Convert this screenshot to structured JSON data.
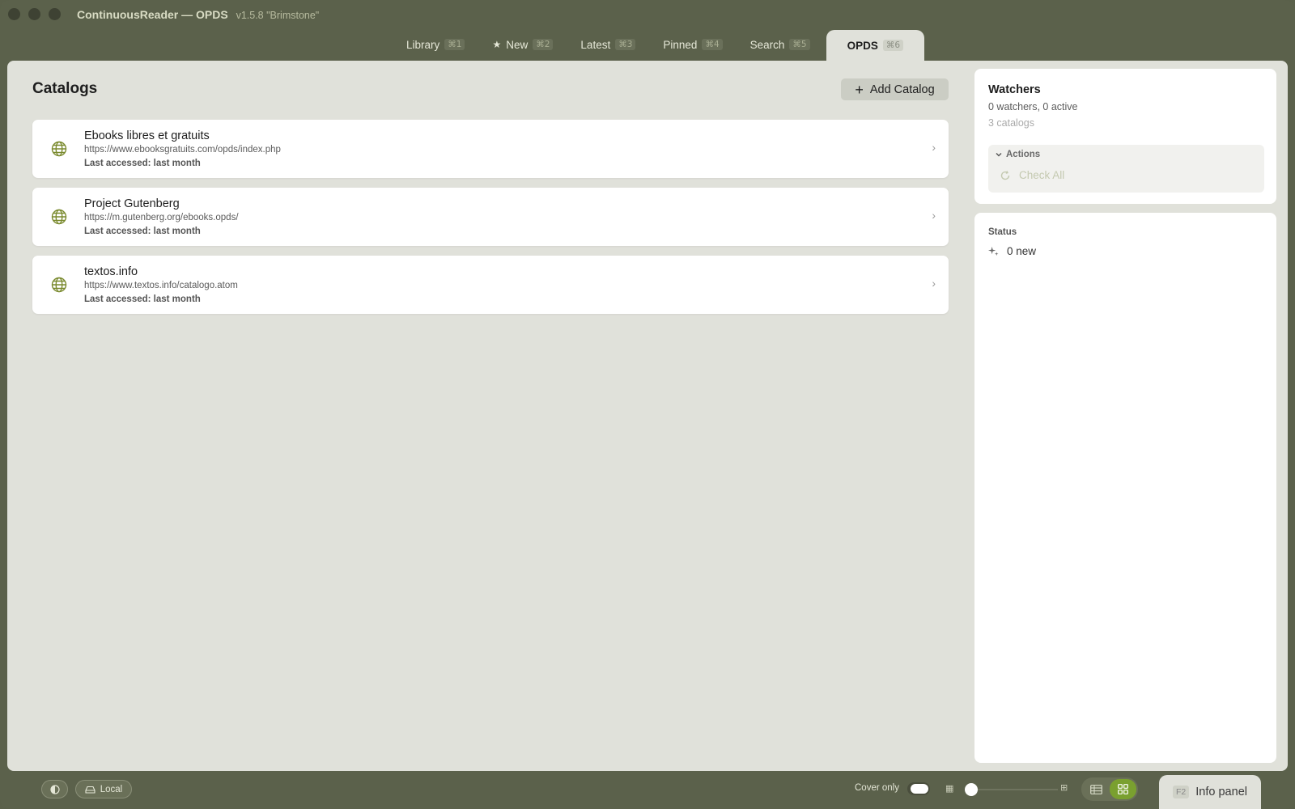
{
  "window": {
    "app_title": "ContinuousReader — OPDS",
    "version": "v1.5.8 \"Brimstone\""
  },
  "tabs": [
    {
      "label": "Library",
      "shortcut": "⌘1",
      "active": false
    },
    {
      "label": "New",
      "shortcut": "⌘2",
      "active": false,
      "icon": "star-icon"
    },
    {
      "label": "Latest",
      "shortcut": "⌘3",
      "active": false
    },
    {
      "label": "Pinned",
      "shortcut": "⌘4",
      "active": false
    },
    {
      "label": "Search",
      "shortcut": "⌘5",
      "active": false
    },
    {
      "label": "OPDS",
      "shortcut": "⌘6",
      "active": true
    }
  ],
  "catalogs_panel": {
    "title": "Catalogs",
    "add_button": "Add Catalog",
    "items": [
      {
        "name": "Ebooks libres et gratuits",
        "url": "https://www.ebooksgratuits.com/opds/index.php",
        "accessed": "Last accessed: last month",
        "icon": "globe-icon"
      },
      {
        "name": "Project Gutenberg",
        "url": "https://m.gutenberg.org/ebooks.opds/",
        "accessed": "Last accessed: last month",
        "icon": "globe-icon"
      },
      {
        "name": "textos.info",
        "url": "https://www.textos.info/catalogo.atom",
        "accessed": "Last accessed: last month",
        "icon": "globe-icon"
      }
    ]
  },
  "watchers": {
    "title": "Watchers",
    "summary": "0 watchers, 0 active",
    "catalog_count": "3 catalogs",
    "actions_label": "Actions",
    "check_all": "Check All"
  },
  "status": {
    "label": "Status",
    "value": "0 new"
  },
  "bottom_bar": {
    "local_label": "Local",
    "cover_only_label": "Cover only",
    "info_panel_key": "F2",
    "info_panel_label": "Info panel"
  },
  "colors": {
    "chrome": "#5b614b",
    "panel": "#e0e1da",
    "accent": "#7aa02f",
    "globe": "#7a8a2e"
  }
}
